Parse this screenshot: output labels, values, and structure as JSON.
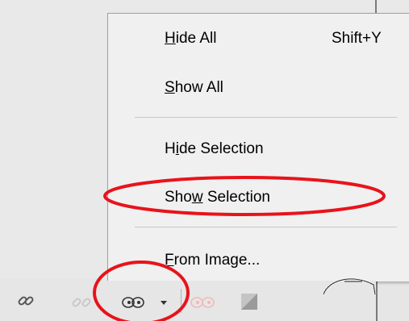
{
  "menu": {
    "items": [
      {
        "pre": "",
        "mn": "H",
        "post": "ide All",
        "shortcut": "Shift+Y"
      },
      {
        "pre": "",
        "mn": "S",
        "post": "how All",
        "shortcut": ""
      },
      {
        "pre": "H",
        "mn": "i",
        "post": "de Selection",
        "shortcut": ""
      },
      {
        "pre": "Sho",
        "mn": "w",
        "post": " Selection",
        "shortcut": ""
      },
      {
        "pre": "",
        "mn": "F",
        "post": "rom Image...",
        "shortcut": ""
      }
    ]
  },
  "toolbar": {
    "icons": [
      "link-icon",
      "unlink-icon",
      "mask-visibility-icon",
      "dropdown-arrow-icon",
      "mask-disabled-icon",
      "mask-square-icon"
    ]
  },
  "colors": {
    "annotation": "#e8131b",
    "menu_bg": "#f0f0f0",
    "toolbar_bg": "#e6e6e6"
  }
}
